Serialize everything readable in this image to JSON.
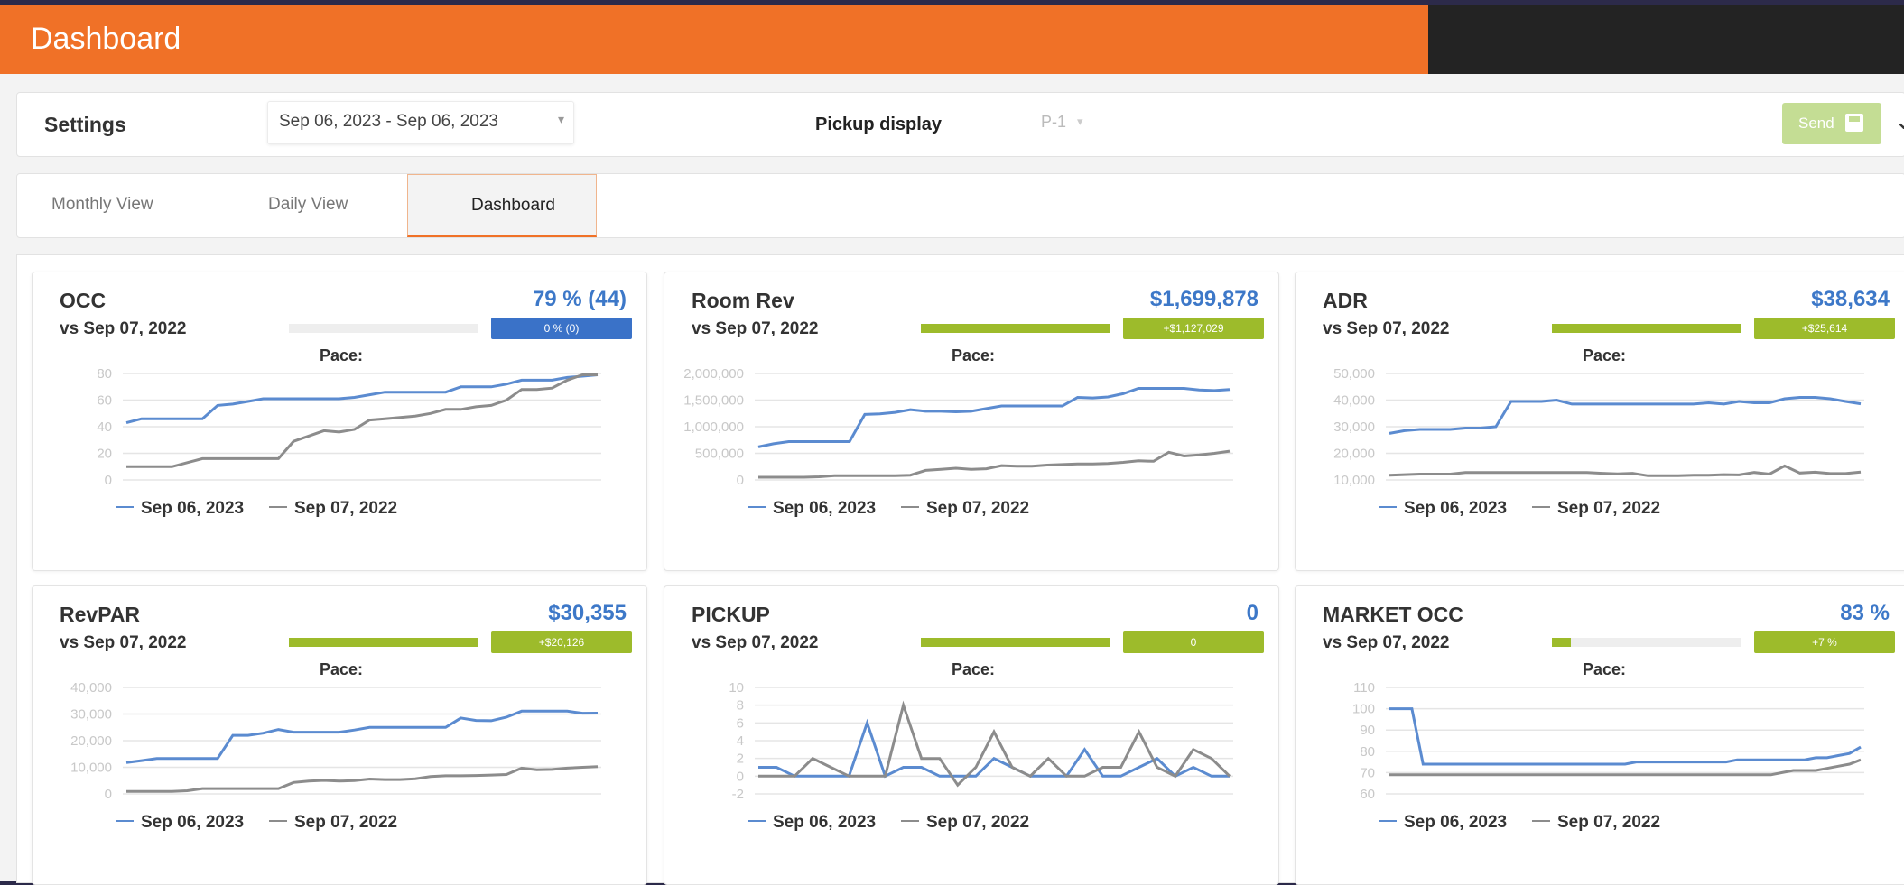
{
  "header": {
    "title": "Dashboard"
  },
  "settings": {
    "label": "Settings",
    "date_range": "Sep 06, 2023 - Sep 06, 2023",
    "pickup_label": "Pickup display",
    "pickup_value": "P-1",
    "send_label": "Send"
  },
  "tabs": [
    {
      "label": "Monthly View",
      "active": false
    },
    {
      "label": "Daily View",
      "active": false
    },
    {
      "label": "Dashboard",
      "active": true
    }
  ],
  "colors": {
    "current": "#5b8bd0",
    "previous": "#8c8c8c",
    "pace_green": "#9dbb2b",
    "pace_blue": "#3a72c8"
  },
  "cards": [
    {
      "title": "OCC",
      "value": "79 % (44)",
      "vs": "vs Sep 07, 2022",
      "pace_label": "Pace:",
      "pace_fill": 0,
      "badge": "0 % (0)",
      "badge_color": "blue",
      "chart_data": {
        "type": "line",
        "ylim": [
          0,
          80
        ],
        "yticks": [
          "0",
          "20",
          "40",
          "60",
          "80"
        ],
        "series": [
          {
            "name": "Sep 06, 2023",
            "values": [
              43,
              46,
              46,
              46,
              46,
              46,
              56,
              57,
              59,
              61,
              61,
              61,
              61,
              61,
              61,
              62,
              64,
              66,
              66,
              66,
              66,
              66,
              70,
              70,
              70,
              72,
              75,
              75,
              75,
              77,
              78,
              79
            ]
          },
          {
            "name": "Sep 07, 2022",
            "values": [
              10,
              10,
              10,
              10,
              13,
              16,
              16,
              16,
              16,
              16,
              16,
              29,
              33,
              37,
              36,
              38,
              45,
              46,
              47,
              48,
              50,
              53,
              53,
              55,
              56,
              60,
              68,
              68,
              69,
              75,
              79,
              79
            ]
          }
        ]
      }
    },
    {
      "title": "Room Rev",
      "value": "$1,699,878",
      "vs": "vs Sep 07, 2022",
      "pace_label": "Pace:",
      "pace_fill": 1,
      "badge": "+$1,127,029",
      "badge_color": "green",
      "chart_data": {
        "type": "line",
        "ylim": [
          0,
          2000000
        ],
        "yticks": [
          "0",
          "500,000",
          "1,000,000",
          "1,500,000",
          "2,000,000"
        ],
        "series": [
          {
            "name": "Sep 06, 2023",
            "values": [
              620000,
              680000,
              720000,
              720000,
              720000,
              720000,
              720000,
              1230000,
              1240000,
              1270000,
              1320000,
              1290000,
              1290000,
              1280000,
              1290000,
              1340000,
              1390000,
              1390000,
              1390000,
              1390000,
              1390000,
              1550000,
              1540000,
              1560000,
              1620000,
              1720000,
              1720000,
              1720000,
              1720000,
              1690000,
              1680000,
              1700000
            ]
          },
          {
            "name": "Sep 07, 2022",
            "values": [
              50000,
              50000,
              50000,
              50000,
              60000,
              80000,
              80000,
              80000,
              80000,
              80000,
              90000,
              180000,
              200000,
              220000,
              200000,
              210000,
              270000,
              260000,
              260000,
              280000,
              290000,
              300000,
              300000,
              310000,
              330000,
              360000,
              350000,
              520000,
              450000,
              470000,
              500000,
              540000
            ]
          }
        ]
      }
    },
    {
      "title": "ADR",
      "value": "$38,634",
      "vs": "vs Sep 07, 2022",
      "pace_label": "Pace:",
      "pace_fill": 1,
      "badge": "+$25,614",
      "badge_color": "green",
      "chart_data": {
        "type": "line",
        "ylim": [
          10000,
          50000
        ],
        "yticks": [
          "10,000",
          "20,000",
          "30,000",
          "40,000",
          "50,000"
        ],
        "series": [
          {
            "name": "Sep 06, 2023",
            "values": [
              27500,
              28500,
              29000,
              29000,
              29000,
              29500,
              29500,
              30000,
              39500,
              39500,
              39500,
              40000,
              38500,
              38500,
              38500,
              38500,
              38500,
              38500,
              38500,
              38500,
              38500,
              39000,
              38500,
              39500,
              39000,
              39000,
              40500,
              41000,
              41000,
              40500,
              39500,
              38600
            ]
          },
          {
            "name": "Sep 07, 2022",
            "values": [
              11800,
              12000,
              12200,
              12200,
              12200,
              12800,
              12800,
              12800,
              12800,
              12800,
              12800,
              12800,
              12800,
              12800,
              12500,
              12300,
              12500,
              11600,
              11600,
              11600,
              11800,
              11800,
              12000,
              11900,
              12800,
              12200,
              15300,
              12600,
              12900,
              12400,
              12400,
              13000
            ]
          }
        ]
      }
    },
    {
      "title": "RevPAR",
      "value": "$30,355",
      "vs": "vs Sep 07, 2022",
      "pace_label": "Pace:",
      "pace_fill": 1,
      "badge": "+$20,126",
      "badge_color": "green",
      "chart_data": {
        "type": "line",
        "ylim": [
          0,
          40000
        ],
        "yticks": [
          "0",
          "10,000",
          "20,000",
          "30,000",
          "40,000"
        ],
        "series": [
          {
            "name": "Sep 06, 2023",
            "values": [
              11800,
              12500,
              13300,
              13300,
              13300,
              13300,
              13300,
              22000,
              22000,
              22800,
              24200,
              23200,
              23200,
              23200,
              23200,
              24000,
              25000,
              25000,
              25000,
              25000,
              25000,
              25000,
              28500,
              27600,
              27500,
              28800,
              31100,
              31100,
              31100,
              31100,
              30300,
              30355
            ]
          },
          {
            "name": "Sep 07, 2022",
            "values": [
              900,
              900,
              900,
              900,
              1200,
              2000,
              2000,
              2000,
              2000,
              2000,
              2000,
              4300,
              4800,
              5100,
              4800,
              5000,
              5600,
              5400,
              5400,
              5700,
              6500,
              6800,
              6800,
              6900,
              7100,
              7300,
              9700,
              9100,
              9200,
              9700,
              10000,
              10229
            ]
          }
        ]
      }
    },
    {
      "title": "PICKUP",
      "value": "0",
      "vs": "vs Sep 07, 2022",
      "pace_label": "Pace:",
      "pace_fill": 1,
      "badge": "0",
      "badge_color": "green",
      "chart_data": {
        "type": "line",
        "ylim": [
          -2,
          10
        ],
        "yticks": [
          "-2",
          "0",
          "2",
          "4",
          "6",
          "8",
          "10"
        ],
        "series": [
          {
            "name": "Sep 06, 2023",
            "values": [
              1,
              1,
              0,
              0,
              0,
              0,
              6,
              0,
              1,
              1,
              0,
              0,
              0,
              2,
              1,
              0,
              0,
              0,
              3,
              0,
              0,
              1,
              2,
              0,
              1,
              0,
              0
            ]
          },
          {
            "name": "Sep 07, 2022",
            "values": [
              0,
              0,
              0,
              2,
              1,
              0,
              0,
              0,
              8,
              2,
              2,
              -1,
              1,
              5,
              1,
              0,
              2,
              0,
              0,
              1,
              1,
              5,
              1,
              0,
              3,
              2,
              0
            ]
          }
        ]
      }
    },
    {
      "title": "MARKET OCC",
      "value": "83 %",
      "vs": "vs Sep 07, 2022",
      "pace_label": "Pace:",
      "pace_fill": 0.1,
      "badge": "+7 %",
      "badge_color": "green",
      "chart_data": {
        "type": "line",
        "ylim": [
          60,
          110
        ],
        "yticks": [
          "60",
          "70",
          "80",
          "90",
          "100",
          "110"
        ],
        "series": [
          {
            "name": "Sep 06, 2023",
            "values": [
              100,
              100,
              100,
              74,
              74,
              74,
              74,
              74,
              74,
              74,
              74,
              74,
              74,
              74,
              74,
              74,
              74,
              74,
              74,
              74,
              74,
              74,
              75,
              75,
              75,
              75,
              75,
              75,
              75,
              75,
              75,
              76,
              76,
              76,
              76,
              76,
              76,
              76,
              77,
              77,
              78,
              79,
              82
            ]
          },
          {
            "name": "Sep 07, 2022",
            "values": [
              69,
              69,
              69,
              69,
              69,
              69,
              69,
              69,
              69,
              69,
              69,
              69,
              69,
              69,
              69,
              69,
              69,
              69,
              69,
              69,
              69,
              69,
              69,
              69,
              69,
              69,
              69,
              69,
              69,
              69,
              69,
              69,
              69,
              69,
              69,
              70,
              71,
              71,
              71,
              72,
              73,
              74,
              76
            ]
          }
        ]
      }
    }
  ]
}
